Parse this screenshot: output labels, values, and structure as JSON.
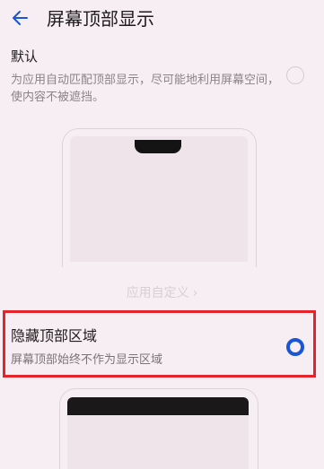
{
  "header": {
    "title": "屏幕顶部显示",
    "back_icon": "back-arrow-icon"
  },
  "options": [
    {
      "title": "默认",
      "description": "为应用自动匹配顶部显示，尽可能地利用屏幕空间，使内容不被遮挡。",
      "selected": false
    },
    {
      "title": "隐藏顶部区域",
      "description": "屏幕顶部始终不作为显示区域",
      "selected": true
    }
  ],
  "custom_link": {
    "label": "应用自定义",
    "icon": "chevron-right-icon"
  },
  "colors": {
    "accent": "#1a55d6",
    "highlight": "#e5232b"
  }
}
